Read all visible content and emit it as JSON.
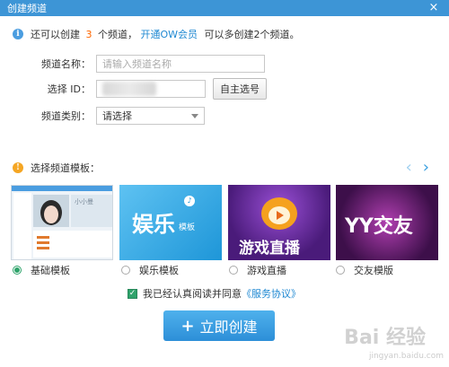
{
  "window": {
    "title": "创建频道",
    "close_icon": "×"
  },
  "info": {
    "prefix": "还可以创建",
    "count": "3",
    "middle": "个频道，",
    "link": "开通OW会员",
    "suffix": "可以多创建2个频道。"
  },
  "form": {
    "name_label": "频道名称：",
    "name_placeholder": "请输入频道名称",
    "id_label": "选择 ID：",
    "self_select_button": "自主选号",
    "category_label": "频道类别：",
    "category_value": "请选择"
  },
  "templates": {
    "heading": "选择频道模板：",
    "items": [
      {
        "label": "基础模板",
        "checked": true,
        "thumb_text": "小小曼"
      },
      {
        "label": "娱乐模板",
        "checked": false,
        "thumb_text": "娱乐",
        "thumb_sub": "模板"
      },
      {
        "label": "游戏直播",
        "checked": false,
        "thumb_text": "游戏直播"
      },
      {
        "label": "交友模版",
        "checked": false,
        "thumb_text": "YY交友"
      }
    ]
  },
  "agreement": {
    "text": "我已经认真阅读并同意",
    "link": "《服务协议》",
    "checked": true
  },
  "create_button": {
    "icon": "+",
    "label": "立即创建"
  },
  "watermark": {
    "text": "Bai 经验",
    "sub": "jingyan.baidu.com"
  },
  "colors": {
    "accent": "#3d95d6",
    "green": "#2fa36b",
    "orange": "#ff6600",
    "info_blue": "#4a9de0"
  }
}
